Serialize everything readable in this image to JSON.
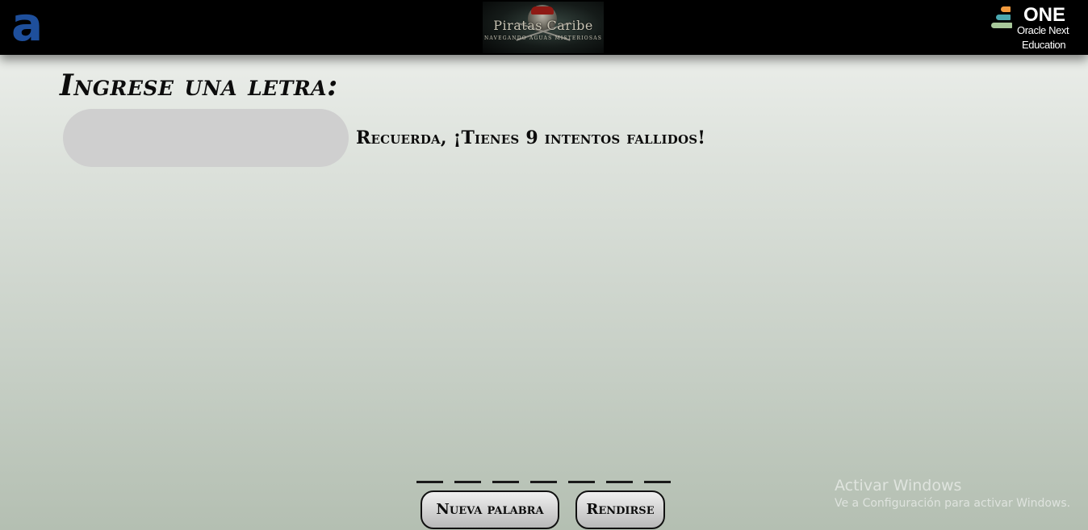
{
  "header": {
    "left_logo": {
      "icon": "alura-a-logo",
      "text": "a",
      "color": "#1e4f9c"
    },
    "center_logo": {
      "title": "Piratas Caribe",
      "subtitle": "NAVEGANDO AGUAS MISTERIOSAS"
    },
    "right_logo": {
      "icon": "oracle-one-stairs-logo",
      "line1": "ONE",
      "line2": "Oracle Next",
      "line3": "Education"
    }
  },
  "game": {
    "prompt": "Ingrese una letra:",
    "input": {
      "value": "",
      "placeholder": ""
    },
    "hint": "Recuerda, ¡Tienes 9 intentos fallidos!",
    "slots_count": 7
  },
  "buttons": {
    "new_word": "Nueva palabra",
    "give_up": "Rendirse"
  },
  "watermark": {
    "title": "Activar Windows",
    "subtitle": "Ve a Configuración para activar Windows."
  },
  "colors": {
    "topbar": "#000000",
    "input_bg": "#cfcfcf",
    "text": "#0c0c0c"
  }
}
